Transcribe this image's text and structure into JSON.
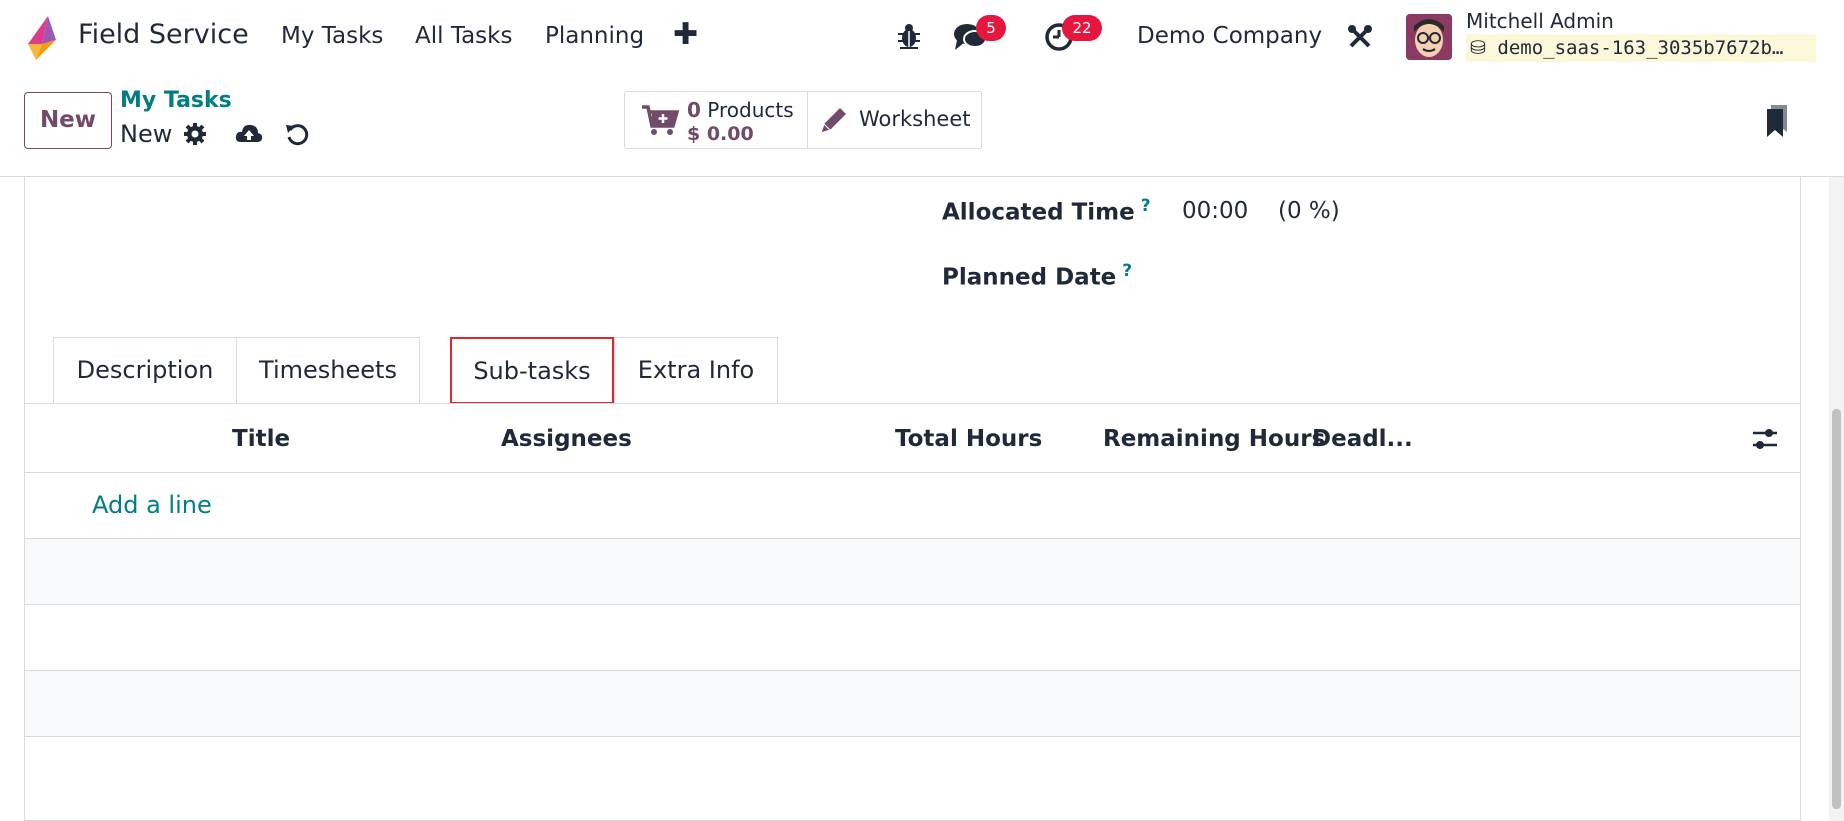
{
  "navbar": {
    "app_name": "Field Service",
    "menu": [
      "My Tasks",
      "All Tasks",
      "Planning"
    ],
    "plus_symbol": "✚",
    "messages_badge": "5",
    "activities_badge": "22",
    "company": "Demo Company",
    "user_name": "Mitchell Admin",
    "database": "demo_saas-163_3035b7672b…"
  },
  "control": {
    "new_button": "New",
    "breadcrumb_parent": "My Tasks",
    "breadcrumb_current": "New",
    "products_count": "0",
    "products_label": "Products",
    "products_price": "$ 0.00",
    "worksheet_label": "Worksheet"
  },
  "form": {
    "allocated_time_label": "Allocated Time",
    "allocated_time_value": "00:00",
    "allocated_time_percent": "(0 %)",
    "planned_date_label": "Planned Date",
    "help_mark": "?"
  },
  "tabs": [
    "Description",
    "Timesheets",
    "Sub-tasks",
    "Extra Info"
  ],
  "active_tab": "Sub-tasks",
  "table": {
    "columns": [
      "Title",
      "Assignees",
      "Total Hours",
      "Remaining Hours",
      "Deadl..."
    ],
    "add_line": "Add a line"
  },
  "colors": {
    "brand": "#714b67",
    "link": "#017e84",
    "badge": "#e5173f",
    "highlight": "#e1262d"
  },
  "icons": [
    "app-logo-icon",
    "bug-icon",
    "chat-icon",
    "clock-icon",
    "tools-icon",
    "database-icon",
    "gear-icon",
    "cloud-upload-icon",
    "undo-icon",
    "cart-icon",
    "pencil-icon",
    "bookmark-icon",
    "column-settings-icon"
  ]
}
